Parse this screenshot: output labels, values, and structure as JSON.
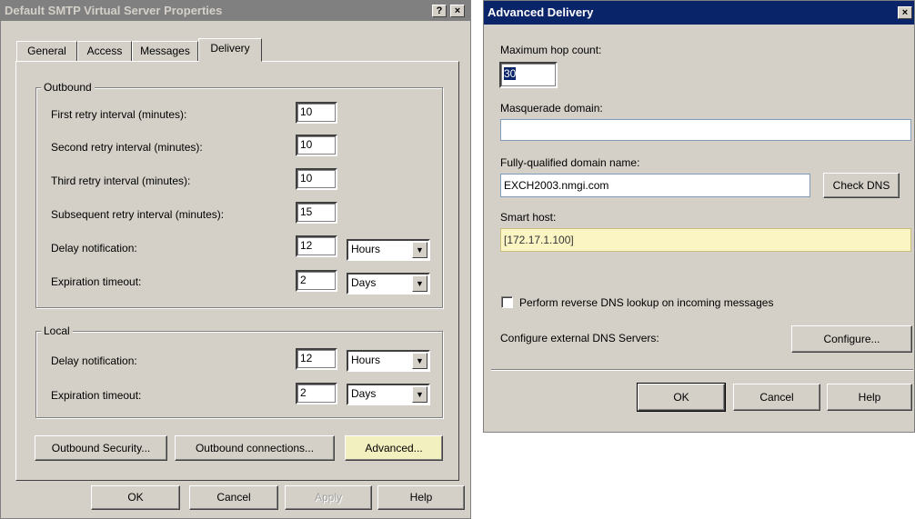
{
  "left": {
    "title": "Default SMTP Virtual Server Properties",
    "help_glyph": "?",
    "close_glyph": "×",
    "tabs": [
      {
        "label": "General"
      },
      {
        "label": "Access"
      },
      {
        "label": "Messages"
      },
      {
        "label": "Delivery"
      }
    ],
    "outbound": {
      "group_label": "Outbound",
      "first_retry": {
        "label": "First retry interval (minutes):",
        "value": "10"
      },
      "second_retry": {
        "label": "Second retry interval (minutes):",
        "value": "10"
      },
      "third_retry": {
        "label": "Third retry interval (minutes):",
        "value": "10"
      },
      "subsequent_retry": {
        "label": "Subsequent retry interval (minutes):",
        "value": "15"
      },
      "delay_notification": {
        "label": "Delay notification:",
        "value": "12",
        "unit": "Hours"
      },
      "expiration_timeout": {
        "label": "Expiration timeout:",
        "value": "2",
        "unit": "Days"
      }
    },
    "local": {
      "group_label": "Local",
      "delay_notification": {
        "label": "Delay notification:",
        "value": "12",
        "unit": "Hours"
      },
      "expiration_timeout": {
        "label": "Expiration timeout:",
        "value": "2",
        "unit": "Days"
      }
    },
    "buttons": {
      "outbound_security": "Outbound Security...",
      "outbound_connections": "Outbound connections...",
      "advanced": "Advanced...",
      "ok": "OK",
      "cancel": "Cancel",
      "apply": "Apply",
      "help": "Help"
    }
  },
  "right": {
    "title": "Advanced Delivery",
    "close_glyph": "×",
    "max_hop": {
      "label": "Maximum hop count:",
      "value": "30"
    },
    "masquerade": {
      "label": "Masquerade domain:",
      "value": ""
    },
    "fqdn": {
      "label": "Fully-qualified domain name:",
      "value": "EXCH2003.nmgi.com"
    },
    "check_dns": "Check DNS",
    "smart_host": {
      "label": "Smart host:",
      "value": "[172.17.1.100]"
    },
    "reverse_dns": {
      "label": "Perform reverse DNS lookup on incoming messages",
      "checked": false
    },
    "ext_dns_label": "Configure external DNS Servers:",
    "configure": "Configure...",
    "ok": "OK",
    "cancel": "Cancel",
    "help": "Help"
  },
  "icons": {
    "dropdown_arrow": "▼"
  }
}
